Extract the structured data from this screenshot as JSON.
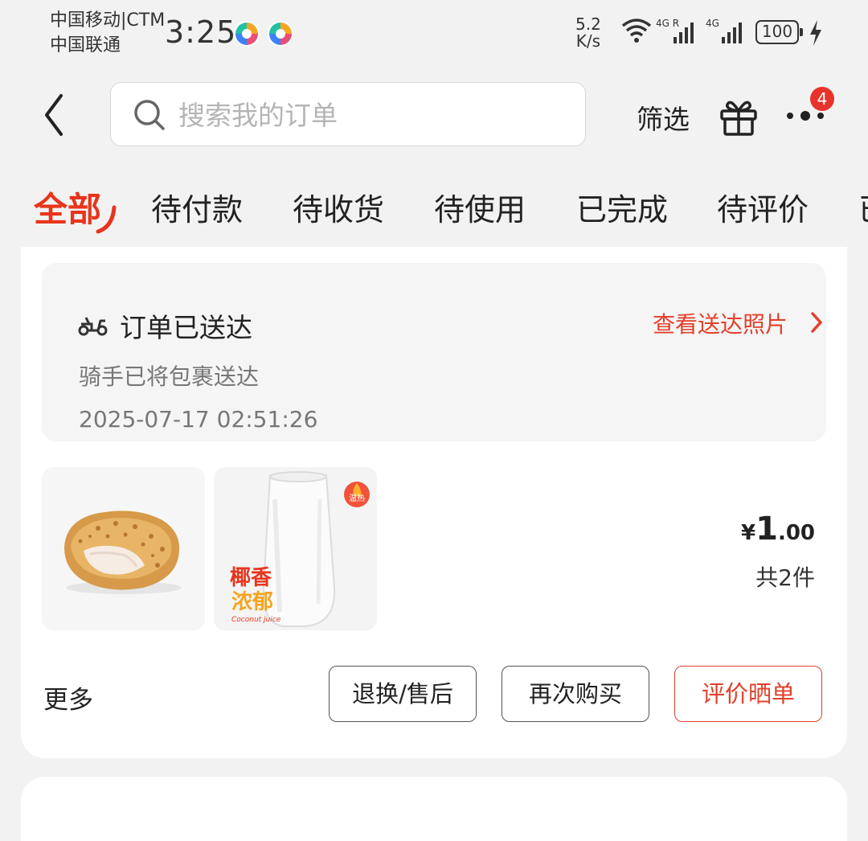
{
  "status_bar": {
    "carrier1": "中国移动|CTM",
    "carrier2": "中国联通",
    "time": "3:25",
    "net_speed_value": "5.2",
    "net_speed_unit": "K/s",
    "sim1_type": "4G R",
    "sim2_type": "4G",
    "battery": "100"
  },
  "header": {
    "search_placeholder": "搜索我的订单",
    "filter_label": "筛选",
    "more_badge": "4"
  },
  "tabs": [
    {
      "label": "全部",
      "active": true
    },
    {
      "label": "待付款"
    },
    {
      "label": "待收货"
    },
    {
      "label": "待使用"
    },
    {
      "label": "已完成"
    },
    {
      "label": "待评价"
    },
    {
      "label": "已"
    }
  ],
  "order": {
    "status_title": "订单已送达",
    "view_photo_link": "查看送达照片",
    "status_desc": "骑手已将包裹送达",
    "status_time": "2025-07-17 02:51:26",
    "products": [
      {
        "name_icon": "fried-chicken-image"
      },
      {
        "name_icon": "coconut-juice-image",
        "brand_line1": "椰香",
        "brand_line2": "浓郁",
        "brand_sub": "Coconut juice",
        "tag": "温热"
      }
    ],
    "price": {
      "currency": "¥",
      "integer": "1",
      "decimal": ".00"
    },
    "item_count": "共2件",
    "more_label": "更多",
    "buttons": {
      "return": "退换/售后",
      "rebuy": "再次购买",
      "review": "评价晒单"
    }
  },
  "colors": {
    "accent": "#e8341c",
    "link": "#e2402c",
    "badge": "#e7332b"
  }
}
